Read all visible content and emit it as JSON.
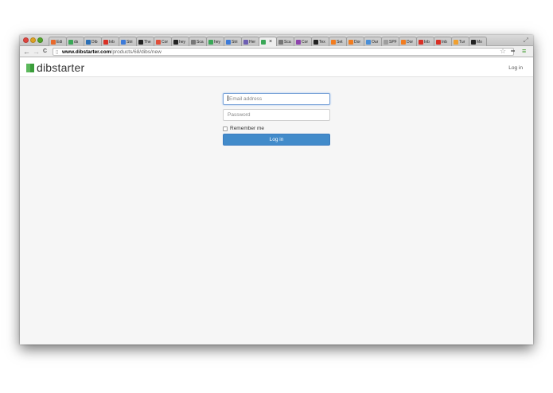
{
  "browser": {
    "tabs": [
      {
        "label": "Edi",
        "icon": "puzzle-icon",
        "color": "#e8692c"
      },
      {
        "label": "ds",
        "icon": "sheet-icon",
        "color": "#3aa757"
      },
      {
        "label": "Dib",
        "icon": "doc-icon",
        "color": "#2a6fb6"
      },
      {
        "label": "Inb",
        "icon": "gmail-icon",
        "color": "#d93025"
      },
      {
        "label": "Stri",
        "icon": "stripe-icon",
        "color": "#3d7bd9"
      },
      {
        "label": "The",
        "icon": "e-icon",
        "color": "#222222"
      },
      {
        "label": "Cor",
        "icon": "c-icon",
        "color": "#e04f3a"
      },
      {
        "label": "hey",
        "icon": "github-icon",
        "color": "#222222"
      },
      {
        "label": "Sca",
        "icon": "box-icon",
        "color": "#777777"
      },
      {
        "label": "hey",
        "icon": "bolt-icon",
        "color": "#3aa757"
      },
      {
        "label": "Stri",
        "icon": "stripe-icon",
        "color": "#3d7bd9"
      },
      {
        "label": "Her",
        "icon": "h-icon",
        "color": "#6e5fb3"
      },
      {
        "label": "",
        "icon": "dibstarter-icon",
        "color": "#3aa757"
      },
      {
        "label": "Sca",
        "icon": "box-icon",
        "color": "#777777"
      },
      {
        "label": "Cor",
        "icon": "c-icon",
        "color": "#8e44ad"
      },
      {
        "label": "Tex",
        "icon": "t-icon",
        "color": "#222222"
      },
      {
        "label": "Set",
        "icon": "hn-icon",
        "color": "#f27c1f"
      },
      {
        "label": "Dor",
        "icon": "hn-icon",
        "color": "#f27c1f"
      },
      {
        "label": "Our",
        "icon": "m-icon",
        "color": "#4a8fd8"
      },
      {
        "label": "SPF",
        "icon": "page-icon",
        "color": "#9e9e9e"
      },
      {
        "label": "Dor",
        "icon": "hn-icon",
        "color": "#f27c1f"
      },
      {
        "label": "Inb",
        "icon": "gmail-icon",
        "color": "#d93025"
      },
      {
        "label": "Inb",
        "icon": "gmail-icon",
        "color": "#d93025"
      },
      {
        "label": "Tur",
        "icon": "ring-icon",
        "color": "#f0a030"
      },
      {
        "label": "Mo",
        "icon": "e-icon",
        "color": "#222222"
      }
    ],
    "active_tab_index": 12,
    "close_glyph": "×",
    "url_host": "www.dibstarter.com",
    "url_path": "/products/68/dibs/new",
    "nav_back": "←",
    "nav_forward": "→",
    "nav_reload": "C"
  },
  "site": {
    "name": "dibstarter",
    "login_link": "Log in",
    "logo_colors": [
      "#5cb85c",
      "#3a9d3a"
    ]
  },
  "form": {
    "email_placeholder": "Email address",
    "password_placeholder": "Password",
    "remember_label": "Remember me",
    "submit_label": "Log in"
  }
}
